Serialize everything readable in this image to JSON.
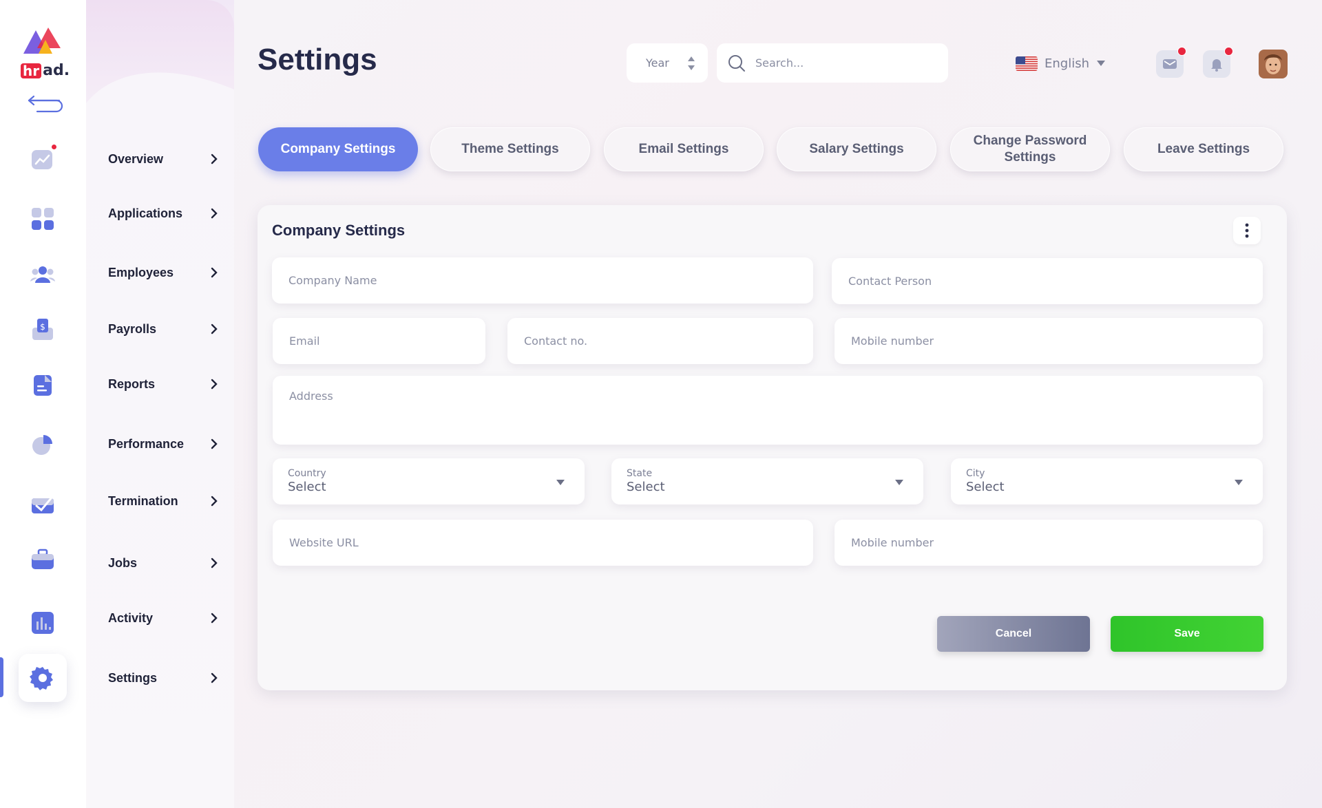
{
  "brand": {
    "logo_hr": "hr",
    "logo_ad": "ad."
  },
  "header": {
    "title": "Settings",
    "year_label": "Year",
    "search_placeholder": "Search...",
    "language": "English"
  },
  "sidebar": {
    "items": [
      {
        "label": "Overview",
        "icon": "chart-line-icon"
      },
      {
        "label": "Applications",
        "icon": "grid-icon"
      },
      {
        "label": "Employees",
        "icon": "users-icon"
      },
      {
        "label": "Payrolls",
        "icon": "dollar-envelope-icon"
      },
      {
        "label": "Reports",
        "icon": "document-icon"
      },
      {
        "label": "Performance",
        "icon": "pie-chart-icon"
      },
      {
        "label": "Termination",
        "icon": "briefcase-check-icon"
      },
      {
        "label": "Jobs",
        "icon": "suitcase-icon"
      },
      {
        "label": "Activity",
        "icon": "bar-chart-icon"
      },
      {
        "label": "Settings",
        "icon": "gear-icon"
      }
    ],
    "active": "Settings"
  },
  "tabs": [
    {
      "label": "Company Settings",
      "active": true
    },
    {
      "label": "Theme Settings",
      "active": false
    },
    {
      "label": "Email Settings",
      "active": false
    },
    {
      "label": "Salary Settings",
      "active": false
    },
    {
      "label": "Change Password Settings",
      "active": false
    },
    {
      "label": "Leave Settings",
      "active": false
    }
  ],
  "form": {
    "title": "Company Settings",
    "company_name_placeholder": "Company Name",
    "contact_person_placeholder": "Contact Person",
    "email_placeholder": "Email",
    "contact_no_placeholder": "Contact no.",
    "mobile_placeholder": "Mobile number",
    "address_placeholder": "Address",
    "country": {
      "label": "Country",
      "value": "Select"
    },
    "state": {
      "label": "State",
      "value": "Select"
    },
    "city": {
      "label": "City",
      "value": "Select"
    },
    "website_placeholder": "Website URL",
    "mobile2_placeholder": "Mobile number",
    "cancel_label": "Cancel",
    "save_label": "Save"
  },
  "colors": {
    "accent": "#6a7ee8",
    "save": "#35c92e",
    "cancel": "#8a8ea8",
    "notification": "#e8263f"
  }
}
